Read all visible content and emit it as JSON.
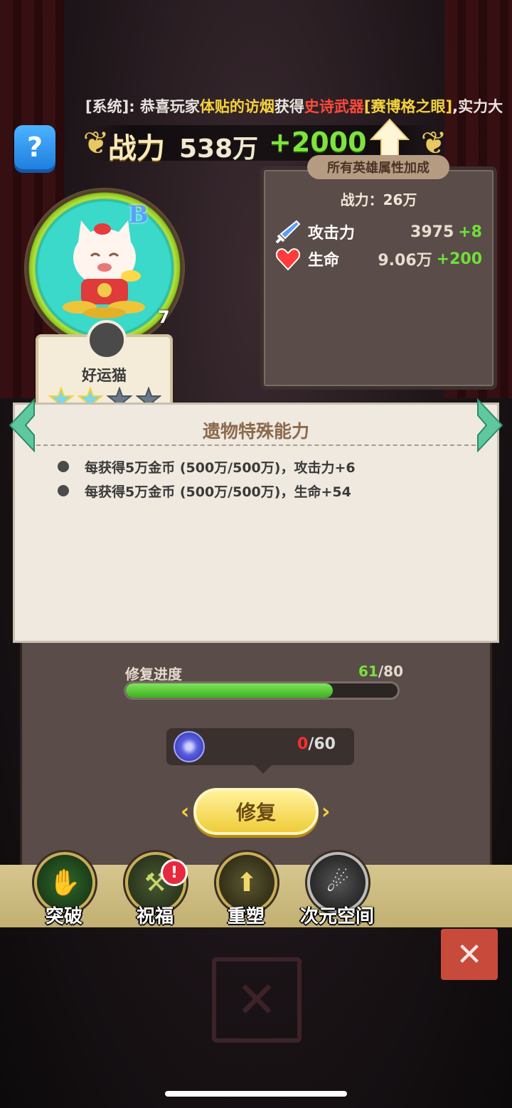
{
  "marquee": {
    "prefix": "[系统]: 恭喜玩家",
    "player": "体贴的访烟",
    "mid": "获得",
    "item_type": "史诗武器",
    "item_name": "[赛博格之眼]",
    "suffix": ",实力大"
  },
  "help_icon": "?",
  "power": {
    "label": "战力",
    "value": "538万",
    "gain": "+2000"
  },
  "stat_panel": {
    "tab": "所有英雄属性加成",
    "power_line": "战力：26万",
    "rows": [
      {
        "icon": "sword-icon",
        "name": "攻击力",
        "value": "3975",
        "bonus": "+8"
      },
      {
        "icon": "heart-icon",
        "name": "生命",
        "value": "9.06万",
        "bonus": "+200"
      }
    ]
  },
  "hero": {
    "name": "好运猫",
    "grade": "B",
    "level": "7",
    "stars_filled": 2,
    "stars_total": 4
  },
  "ability": {
    "title": "遗物特殊能力",
    "items": [
      "每获得5万金币 (500万/500万)，攻击力+6",
      "每获得5万金币 (500万/500万)，生命+54"
    ]
  },
  "repair": {
    "label": "修复进度",
    "current": "61",
    "sep_total": "/80",
    "progress": 0.7625,
    "material_current": "0",
    "material_total": "/60",
    "button": "修复"
  },
  "nav": [
    {
      "label": "突破",
      "icon": "breakthrough-icon"
    },
    {
      "label": "祝福",
      "icon": "blessing-icon",
      "badge": "!"
    },
    {
      "label": "重塑",
      "icon": "reshape-icon"
    },
    {
      "label": "次元空间",
      "icon": "dimension-icon"
    }
  ],
  "close_icon": "✕",
  "colors": {
    "accent_green": "#7be03c",
    "warn_red": "#ff2d2d",
    "gold": "#f4d23c",
    "panel": "#5a4c48"
  }
}
